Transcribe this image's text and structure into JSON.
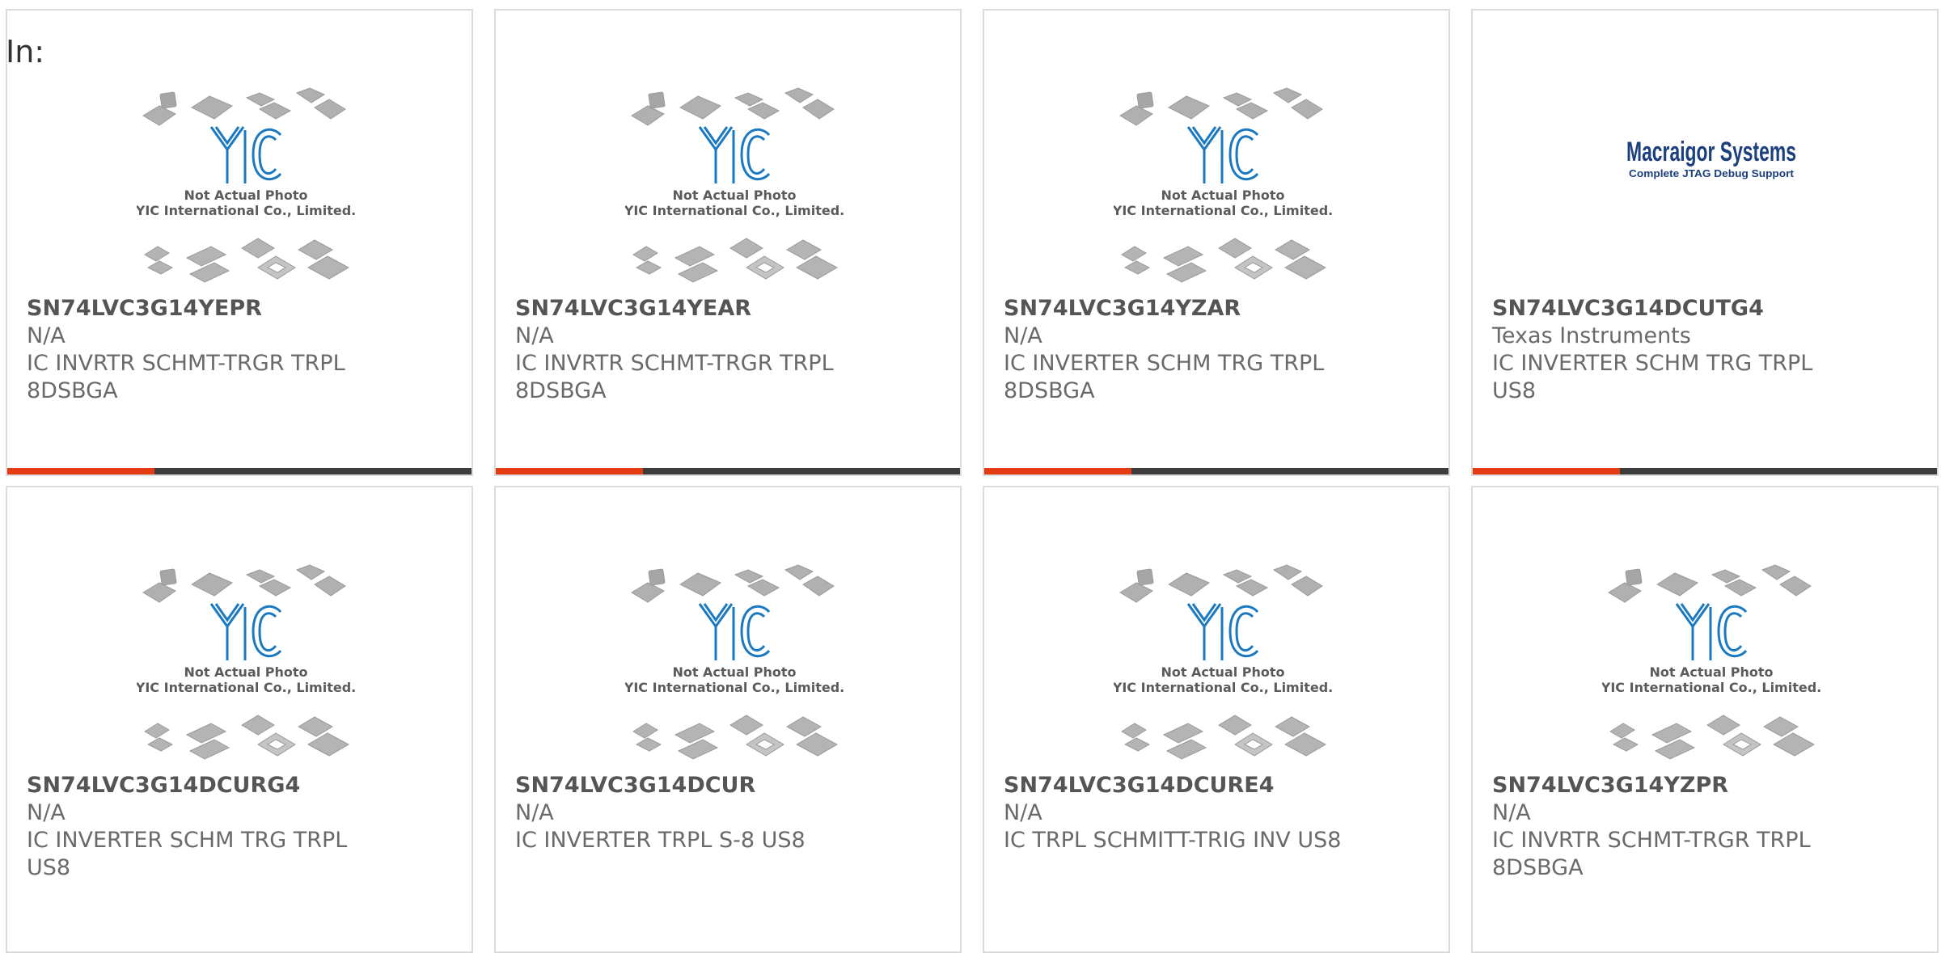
{
  "header": {
    "label": "In:"
  },
  "placeholder": {
    "line1": "Not Actual Photo",
    "line2": "YIC International Co., Limited.",
    "brand": "YIC"
  },
  "logo_text": {
    "name": "Macraigor Systems",
    "tagline": "Complete JTAG Debug Support"
  },
  "colors": {
    "accent": "#e53b12",
    "bar": "#3c3c3c",
    "yic_blue": "#1a79c0",
    "logo_blue": "#1c3f7d"
  },
  "products": [
    {
      "part": "SN74LVC3G14YEPR",
      "mfr": "N/A",
      "desc": "IC INVRTR SCHMT-TRGR TRPL 8DSBGA",
      "image": "yic-placeholder"
    },
    {
      "part": "SN74LVC3G14YEAR",
      "mfr": "N/A",
      "desc": "IC INVRTR SCHMT-TRGR TRPL 8DSBGA",
      "image": "yic-placeholder"
    },
    {
      "part": "SN74LVC3G14YZAR",
      "mfr": "N/A",
      "desc": "IC INVERTER SCHM TRG TRPL 8DSBGA",
      "image": "yic-placeholder"
    },
    {
      "part": "SN74LVC3G14DCUTG4",
      "mfr": "Texas Instruments",
      "desc": "IC INVERTER SCHM TRG TRPL US8",
      "image": "macraigor-logo"
    },
    {
      "part": "SN74LVC3G14DCURG4",
      "mfr": "N/A",
      "desc": "IC INVERTER SCHM TRG TRPL US8",
      "image": "yic-placeholder"
    },
    {
      "part": "SN74LVC3G14DCUR",
      "mfr": "N/A",
      "desc": "IC INVERTER TRPL S-8 US8",
      "image": "yic-placeholder"
    },
    {
      "part": "SN74LVC3G14DCURE4",
      "mfr": "N/A",
      "desc": "IC TRPL SCHMITT-TRIG INV US8",
      "image": "yic-placeholder"
    },
    {
      "part": "SN74LVC3G14YZPR",
      "mfr": "N/A",
      "desc": "IC INVRTR SCHMT-TRGR TRPL 8DSBGA",
      "image": "yic-placeholder"
    }
  ]
}
